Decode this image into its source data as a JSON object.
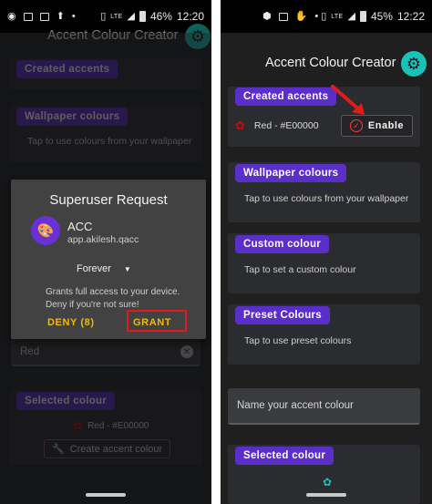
{
  "left": {
    "status": {
      "time": "12:20",
      "battery": "46%"
    },
    "app_title": "Accent Colour Creator",
    "sections": {
      "created_accents": "Created accents",
      "wallpaper": "Wallpaper colours",
      "wallpaper_hint": "Tap to use colours from your wallpaper",
      "selected": "Selected colour"
    },
    "input_value": "Red",
    "selected_color_label": "Red - #E00000",
    "create_button": "Create accent colour",
    "dialog": {
      "title": "Superuser Request",
      "app_name": "ACC",
      "package": "app.akilesh.qacc",
      "duration": "Forever",
      "description_line1": "Grants full access to your device.",
      "description_line2": "Deny if you're not sure!",
      "deny_label": "DENY (8)",
      "grant_label": "GRANT"
    }
  },
  "right": {
    "status": {
      "time": "12:22",
      "battery": "45%"
    },
    "app_title": "Accent Colour Creator",
    "created_accents": "Created accents",
    "accent_item": "Red - #E00000",
    "enable_label": "Enable",
    "wallpaper_title": "Wallpaper colours",
    "wallpaper_hint": "Tap to use colours from your wallpaper",
    "custom_title": "Custom colour",
    "custom_hint": "Tap to set a custom colour",
    "preset_title": "Preset Colours",
    "preset_hint": "Tap to use preset colours",
    "name_placeholder": "Name your accent colour",
    "selected_title": "Selected colour"
  },
  "colors": {
    "accent_teal": "#19c2b6",
    "chip_purple": "#5a2fc9",
    "highlight_red": "#e21b1b",
    "dialog_button": "#f2b900"
  },
  "icons": [
    "settings-gear-icon",
    "palette-icon",
    "wrench-icon",
    "check-circle-icon",
    "clear-icon",
    "dropdown-caret-icon"
  ]
}
